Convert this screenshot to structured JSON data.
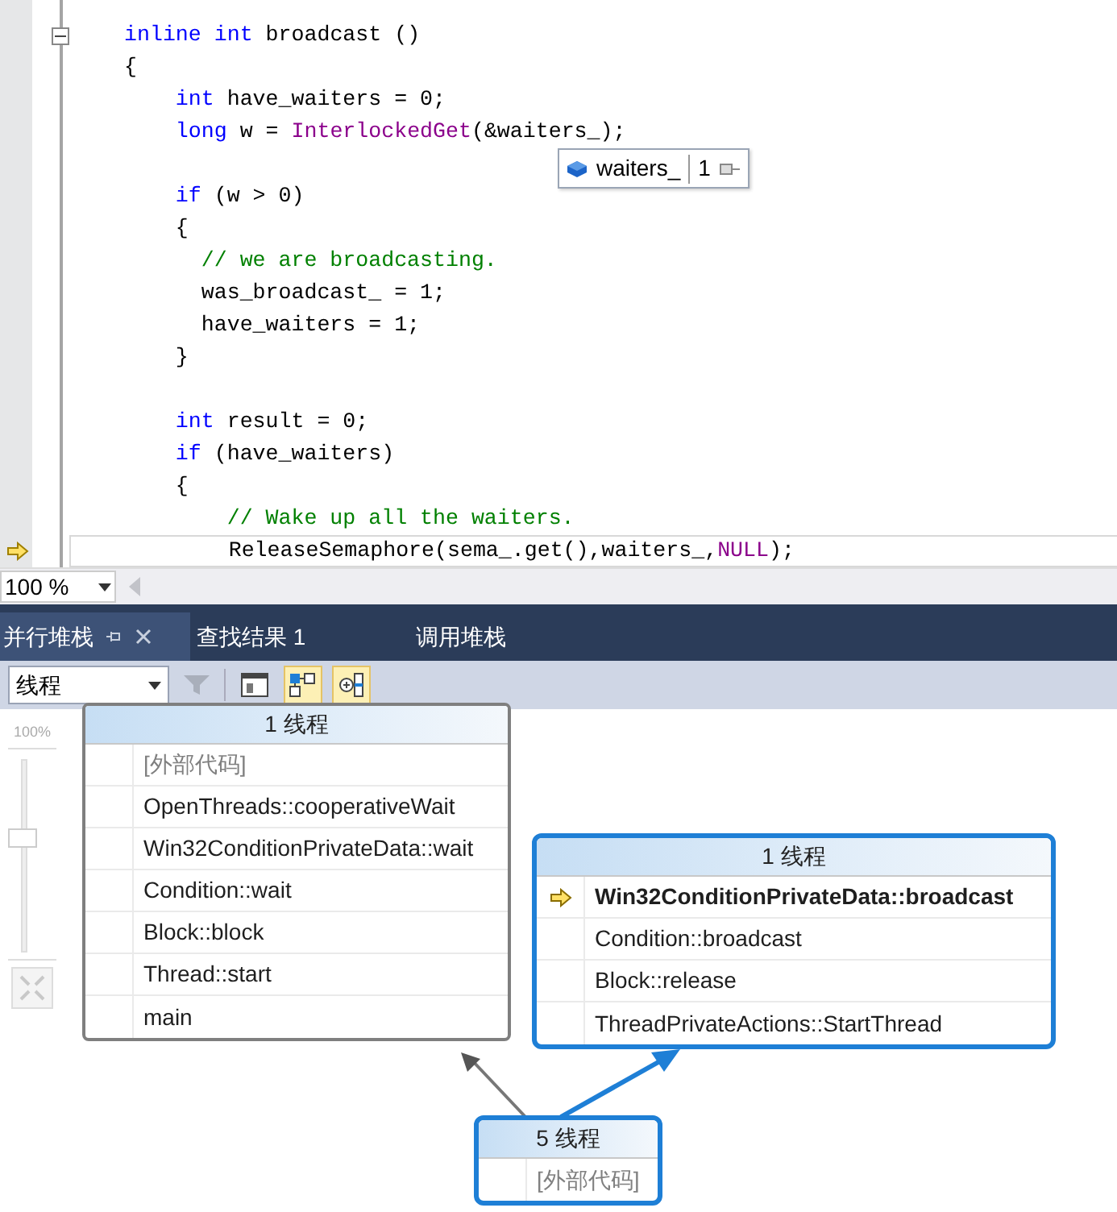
{
  "editor": {
    "lines": [
      {
        "tokens": [
          {
            "kind": "keyword",
            "text": "inline"
          },
          {
            "kind": "keyword",
            "text": " int"
          },
          {
            "kind": "plain",
            "text": " broadcast ()"
          }
        ],
        "collapsible": true,
        "current": false
      },
      {
        "tokens": [
          {
            "kind": "plain",
            "text": "{"
          }
        ],
        "collapsible": false,
        "current": false
      },
      {
        "tokens": [
          {
            "kind": "keyword",
            "text": "    int"
          },
          {
            "kind": "plain",
            "text": " have_waiters = 0;"
          }
        ],
        "collapsible": false,
        "current": false
      },
      {
        "tokens": [
          {
            "kind": "keyword",
            "text": "    long"
          },
          {
            "kind": "plain",
            "text": " w = "
          },
          {
            "kind": "function",
            "text": "InterlockedGet"
          },
          {
            "kind": "plain",
            "text": "(&waiters_);"
          }
        ],
        "collapsible": false,
        "current": false
      },
      {
        "collapsible": false,
        "current": false
      },
      {
        "tokens": [
          {
            "kind": "keyword",
            "text": "    if"
          },
          {
            "kind": "plain",
            "text": " (w > 0)"
          }
        ],
        "collapsible": false,
        "current": false
      },
      {
        "tokens": [
          {
            "kind": "plain",
            "text": "    {"
          }
        ],
        "collapsible": false,
        "current": false
      },
      {
        "tokens": [
          {
            "kind": "comment",
            "text": "      // we are broadcasting."
          }
        ],
        "collapsible": false,
        "current": false
      },
      {
        "tokens": [
          {
            "kind": "plain",
            "text": "      was_broadcast_ = 1;"
          }
        ],
        "collapsible": false,
        "current": false
      },
      {
        "tokens": [
          {
            "kind": "plain",
            "text": "      have_waiters = 1;"
          }
        ],
        "collapsible": false,
        "current": false
      },
      {
        "tokens": [
          {
            "kind": "plain",
            "text": "    }"
          }
        ],
        "collapsible": false,
        "current": false
      },
      {
        "collapsible": false,
        "current": false
      },
      {
        "tokens": [
          {
            "kind": "keyword",
            "text": "    int"
          },
          {
            "kind": "plain",
            "text": " result = 0;"
          }
        ],
        "collapsible": false,
        "current": false
      },
      {
        "tokens": [
          {
            "kind": "keyword",
            "text": "    if"
          },
          {
            "kind": "plain",
            "text": " (have_waiters)"
          }
        ],
        "collapsible": false,
        "current": false
      },
      {
        "tokens": [
          {
            "kind": "plain",
            "text": "    {"
          }
        ],
        "collapsible": false,
        "current": false
      },
      {
        "tokens": [
          {
            "kind": "comment",
            "text": "        // Wake up all the waiters."
          }
        ],
        "collapsible": false,
        "current": false
      },
      {
        "tokens": [
          {
            "kind": "plain",
            "text": "        ReleaseSemaphore(sema_.get(),waiters_,"
          },
          {
            "kind": "function",
            "text": "NULL"
          },
          {
            "kind": "plain",
            "text": ");"
          }
        ],
        "collapsible": false,
        "current": true
      }
    ],
    "datatip": {
      "name": "waiters_",
      "value": "1"
    },
    "zoom": "100 %"
  },
  "tabs": [
    {
      "label": "并行堆栈",
      "selected": true
    },
    {
      "label": "查找结果 1",
      "selected": false
    },
    {
      "label": "调用堆栈",
      "selected": false
    }
  ],
  "toolbar": {
    "view_select": "线程",
    "filter_enabled": false,
    "toggles": [
      {
        "on": false
      },
      {
        "on": true
      },
      {
        "on": true
      }
    ]
  },
  "zoom_slider": {
    "label": "100%",
    "level": 0.6
  },
  "stacks": [
    {
      "header": "1 线程",
      "selected": false,
      "frames": [
        {
          "text": "[外部代码]",
          "kind": "external",
          "current": false
        },
        {
          "text": "OpenThreads::cooperativeWait",
          "kind": "frame",
          "current": false
        },
        {
          "text": "Win32ConditionPrivateData::wait",
          "kind": "frame",
          "current": false
        },
        {
          "text": "Condition::wait",
          "kind": "frame",
          "current": false
        },
        {
          "text": "Block::block",
          "kind": "frame",
          "current": false
        },
        {
          "text": "Thread::start",
          "kind": "frame",
          "current": false
        },
        {
          "text": "main",
          "kind": "frame",
          "current": false
        }
      ]
    },
    {
      "header": "1 线程",
      "selected": true,
      "frames": [
        {
          "text": "Win32ConditionPrivateData::broadcast",
          "kind": "frame",
          "current": true
        },
        {
          "text": "Condition::broadcast",
          "kind": "frame",
          "current": false
        },
        {
          "text": "Block::release",
          "kind": "frame",
          "current": false
        },
        {
          "text": "ThreadPrivateActions::StartThread",
          "kind": "frame",
          "current": false
        }
      ]
    },
    {
      "header": "5 线程",
      "selected": true,
      "frames": [
        {
          "text": "[外部代码]",
          "kind": "external",
          "current": false
        }
      ]
    }
  ]
}
